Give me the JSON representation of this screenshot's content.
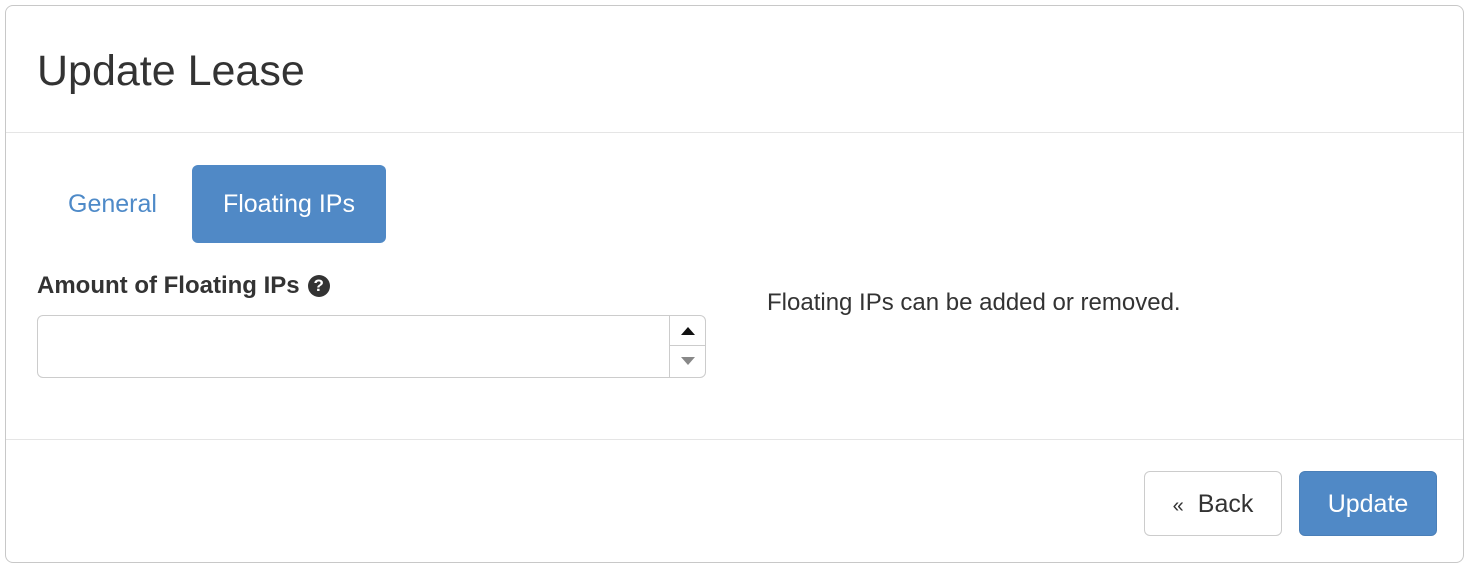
{
  "modal": {
    "title": "Update Lease"
  },
  "tabs": [
    {
      "label": "General",
      "active": false
    },
    {
      "label": "Floating IPs",
      "active": true
    }
  ],
  "form": {
    "amount_label": "Amount of Floating IPs",
    "help_icon": "question-circle-icon",
    "help_icon_glyph": "?",
    "amount_value": "",
    "amount_placeholder": "",
    "description": "Floating IPs can be added or removed."
  },
  "footer": {
    "back_glyph": "«",
    "back_label": "Back",
    "update_label": "Update"
  },
  "colors": {
    "primary": "#5089c6",
    "link": "#4e8ac8",
    "text": "#333333"
  }
}
